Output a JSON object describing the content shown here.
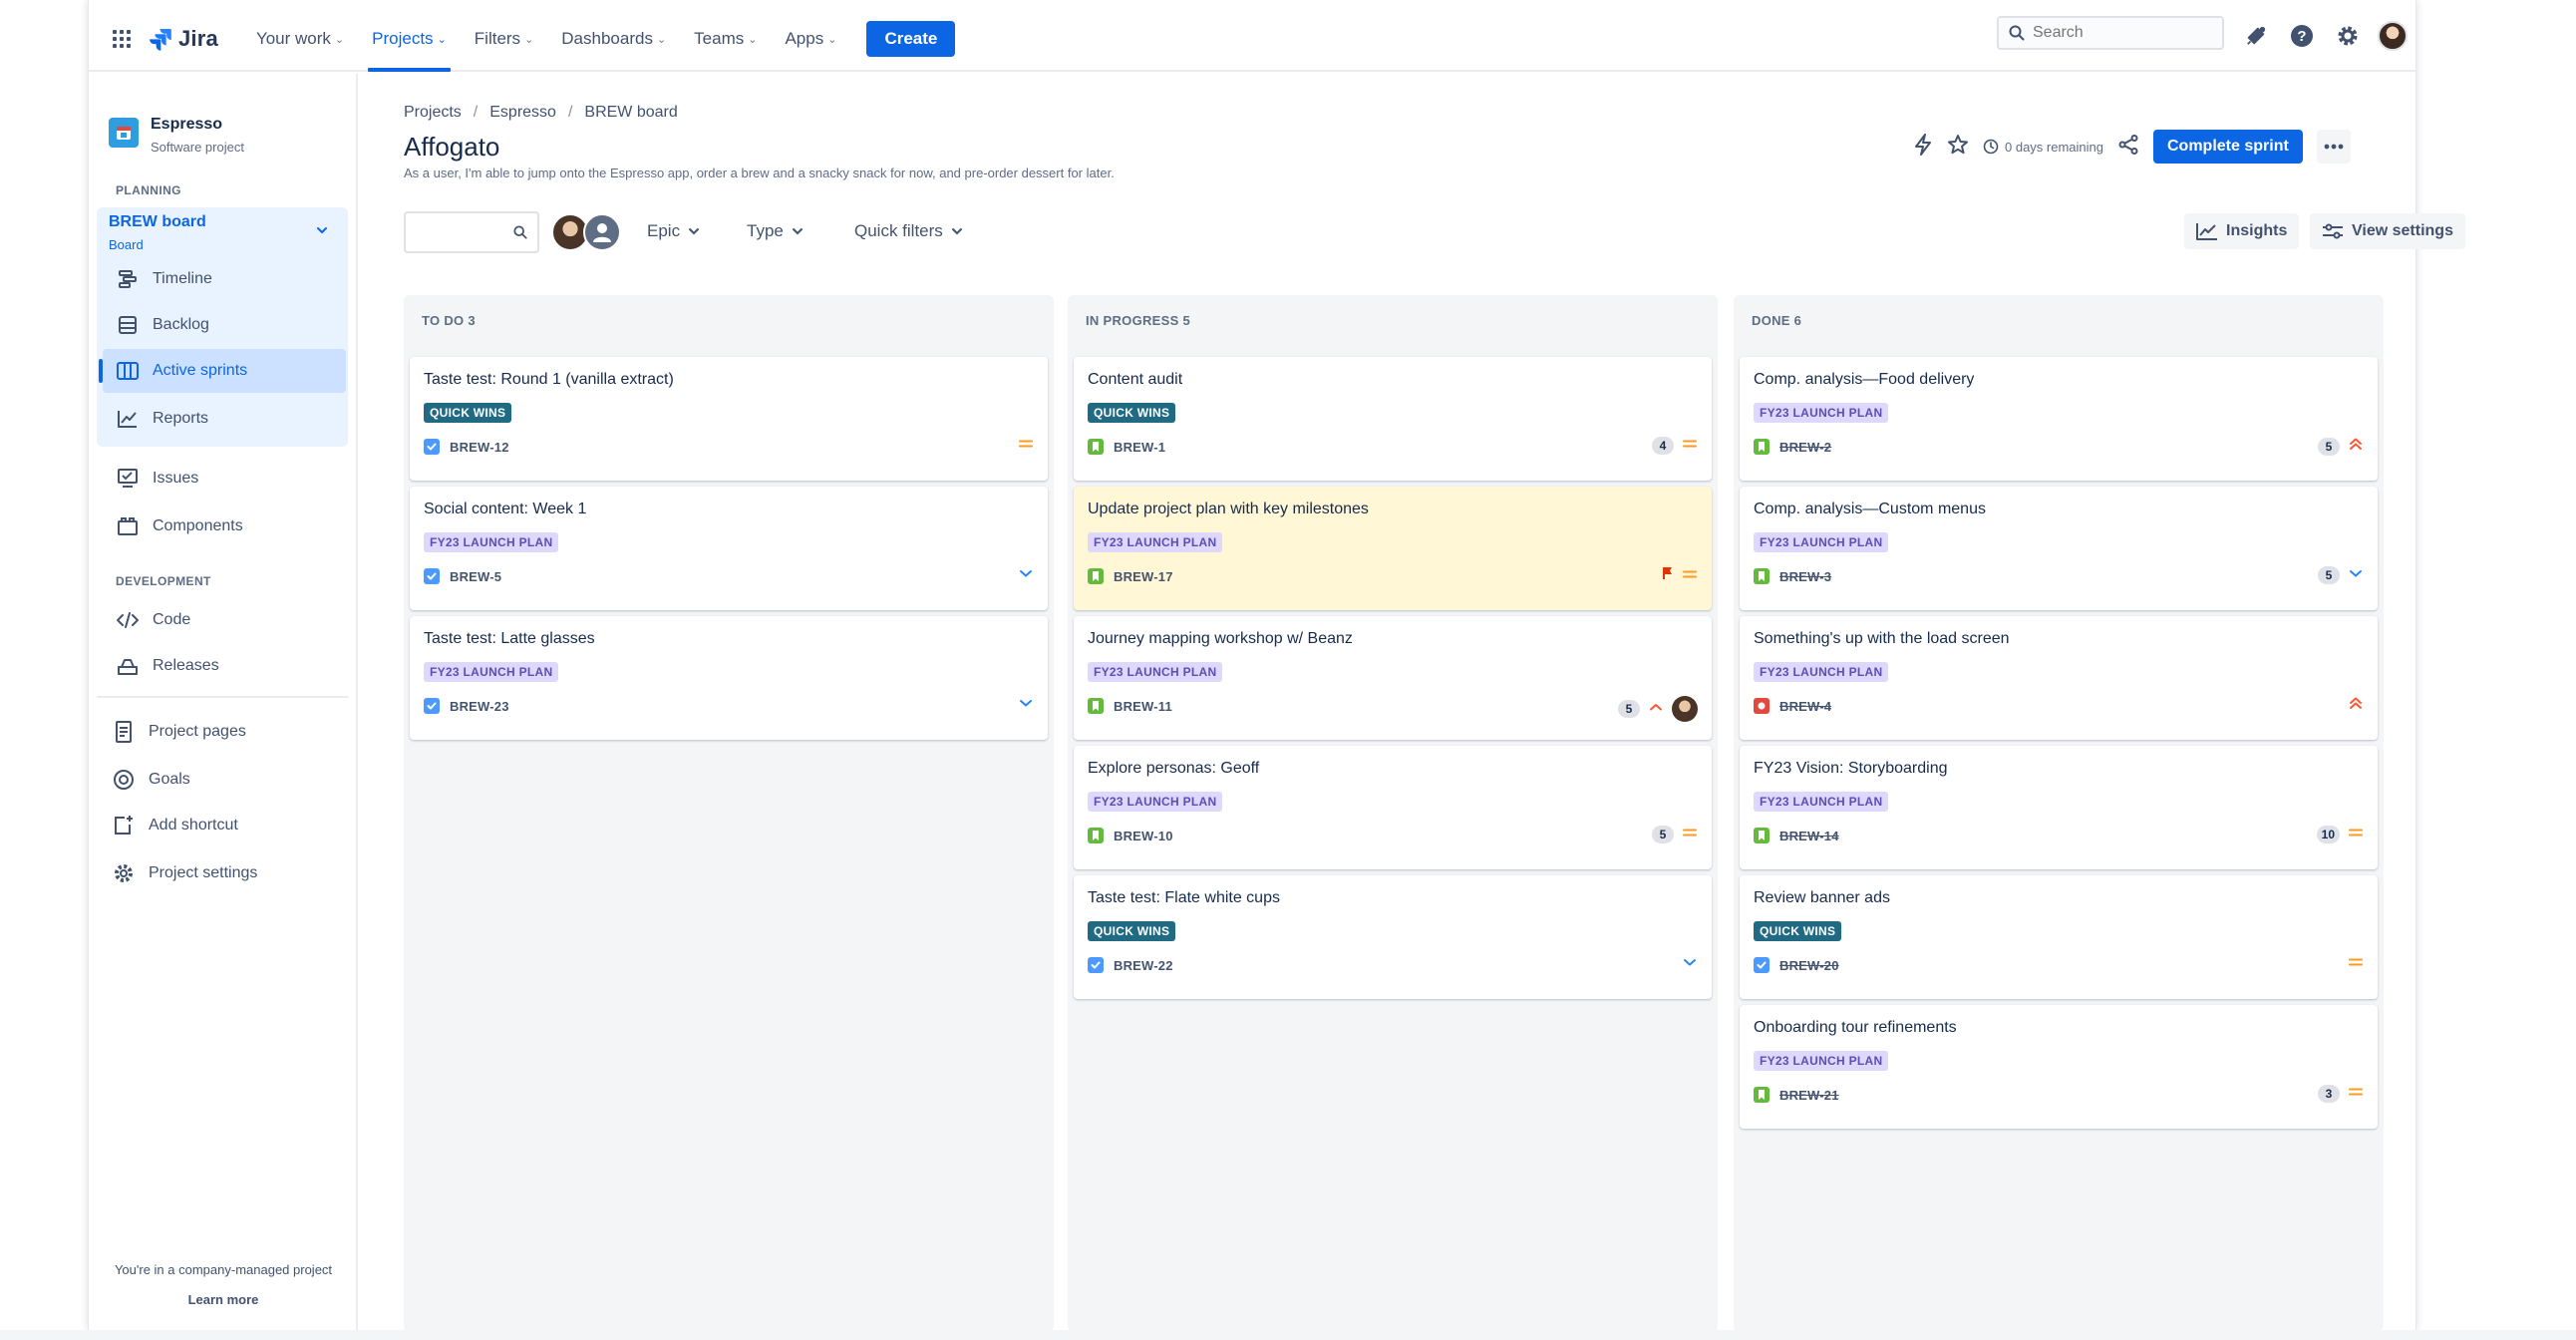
{
  "topnav": {
    "product": "Jira",
    "items": [
      {
        "label": "Your work",
        "active": false
      },
      {
        "label": "Projects",
        "active": true
      },
      {
        "label": "Filters",
        "active": false
      },
      {
        "label": "Dashboards",
        "active": false
      },
      {
        "label": "Teams",
        "active": false
      },
      {
        "label": "Apps",
        "active": false
      }
    ],
    "create_label": "Create",
    "search_placeholder": "Search"
  },
  "sidebar": {
    "project_name": "Espresso",
    "project_type": "Software project",
    "planning_title": "PLANNING",
    "board_title": "BREW board",
    "board_sub": "Board",
    "planning_items": [
      {
        "label": "Timeline",
        "icon": "timeline-icon"
      },
      {
        "label": "Backlog",
        "icon": "backlog-icon"
      },
      {
        "label": "Active sprints",
        "icon": "board-icon",
        "active": true
      },
      {
        "label": "Reports",
        "icon": "reports-icon"
      }
    ],
    "other_items": [
      {
        "label": "Issues",
        "icon": "issues-icon"
      },
      {
        "label": "Components",
        "icon": "components-icon"
      }
    ],
    "development_title": "DEVELOPMENT",
    "development_items": [
      {
        "label": "Code",
        "icon": "code-icon"
      },
      {
        "label": "Releases",
        "icon": "releases-icon"
      }
    ],
    "bottom_items": [
      {
        "label": "Project pages",
        "icon": "pages-icon"
      },
      {
        "label": "Goals",
        "icon": "goals-icon"
      },
      {
        "label": "Add shortcut",
        "icon": "add-shortcut-icon"
      },
      {
        "label": "Project settings",
        "icon": "settings-icon"
      }
    ],
    "footer_text": "You're in a company-managed project",
    "learn_more": "Learn more"
  },
  "breadcrumbs": [
    "Projects",
    "Espresso",
    "BREW board"
  ],
  "page": {
    "title": "Affogato",
    "description": "As a user, I'm able to jump onto the Espresso app, order a brew and a snacky snack for now, and pre-order dessert for later.",
    "days_remaining": "0 days remaining",
    "complete_sprint": "Complete sprint"
  },
  "filters": {
    "epic": "Epic",
    "type": "Type",
    "quick_filters": "Quick filters",
    "insights": "Insights",
    "view_settings": "View settings"
  },
  "columns": [
    {
      "title": "TO DO 3",
      "cards": [
        {
          "title": "Taste test: Round 1 (vanilla extract)",
          "label": "QUICK WINS",
          "label_type": "qw",
          "key": "BREW-12",
          "type": "task",
          "points": "",
          "priority": "medium",
          "done": false
        },
        {
          "title": "Social content: Week 1",
          "label": "FY23 LAUNCH PLAN",
          "label_type": "fy",
          "key": "BREW-5",
          "type": "task",
          "points": "",
          "priority": "low",
          "done": false
        },
        {
          "title": "Taste test: Latte glasses",
          "label": "FY23 LAUNCH PLAN",
          "label_type": "fy",
          "key": "BREW-23",
          "type": "task",
          "points": "",
          "priority": "low",
          "done": false
        }
      ]
    },
    {
      "title": "IN PROGRESS 5",
      "cards": [
        {
          "title": "Content audit",
          "label": "QUICK WINS",
          "label_type": "qw",
          "key": "BREW-1",
          "type": "story",
          "points": "4",
          "priority": "medium",
          "done": false
        },
        {
          "title": "Update project plan with key milestones",
          "label": "FY23 LAUNCH PLAN",
          "label_type": "fy",
          "key": "BREW-17",
          "type": "story",
          "points": "",
          "priority": "medium",
          "flag": true,
          "highlight": true,
          "done": false
        },
        {
          "title": "Journey mapping workshop w/ Beanz",
          "label": "FY23 LAUNCH PLAN",
          "label_type": "fy",
          "key": "BREW-11",
          "type": "story",
          "points": "5",
          "priority": "high",
          "assignee": true,
          "done": false
        },
        {
          "title": "Explore personas: Geoff",
          "label": "FY23 LAUNCH PLAN",
          "label_type": "fy",
          "key": "BREW-10",
          "type": "story",
          "points": "5",
          "priority": "medium",
          "done": false
        },
        {
          "title": "Taste test: Flate white cups",
          "label": "QUICK WINS",
          "label_type": "qw",
          "key": "BREW-22",
          "type": "task",
          "points": "",
          "priority": "low",
          "done": false
        }
      ]
    },
    {
      "title": "DONE 6",
      "cards": [
        {
          "title": "Comp. analysis—Food delivery",
          "label": "FY23 LAUNCH PLAN",
          "label_type": "fy",
          "key": "BREW-2",
          "type": "story",
          "points": "5",
          "priority": "highest",
          "done": true
        },
        {
          "title": "Comp. analysis—Custom menus",
          "label": "FY23 LAUNCH PLAN",
          "label_type": "fy",
          "key": "BREW-3",
          "type": "story",
          "points": "5",
          "priority": "low",
          "done": true
        },
        {
          "title": "Something's up with the load screen",
          "label": "FY23 LAUNCH PLAN",
          "label_type": "fy",
          "key": "BREW-4",
          "type": "bug",
          "points": "",
          "priority": "highest",
          "done": true
        },
        {
          "title": "FY23 Vision: Storyboarding",
          "label": "FY23 LAUNCH PLAN",
          "label_type": "fy",
          "key": "BREW-14",
          "type": "story",
          "points": "10",
          "priority": "medium",
          "done": true
        },
        {
          "title": "Review banner ads",
          "label": "QUICK WINS",
          "label_type": "qw",
          "key": "BREW-20",
          "type": "task",
          "points": "",
          "priority": "medium",
          "done": true
        },
        {
          "title": "Onboarding tour refinements",
          "label": "FY23 LAUNCH PLAN",
          "label_type": "fy",
          "key": "BREW-21",
          "type": "story",
          "points": "3",
          "priority": "medium",
          "done": true
        }
      ]
    }
  ],
  "colors": {
    "accent": "#0c66e4",
    "quick_wins": "#206a83",
    "launch_plan_bg": "#dfd8fd",
    "launch_plan_text": "#5e4db2",
    "priority_medium": "#ff991f",
    "priority_low": "#2684ff",
    "priority_high": "#ff5630"
  }
}
